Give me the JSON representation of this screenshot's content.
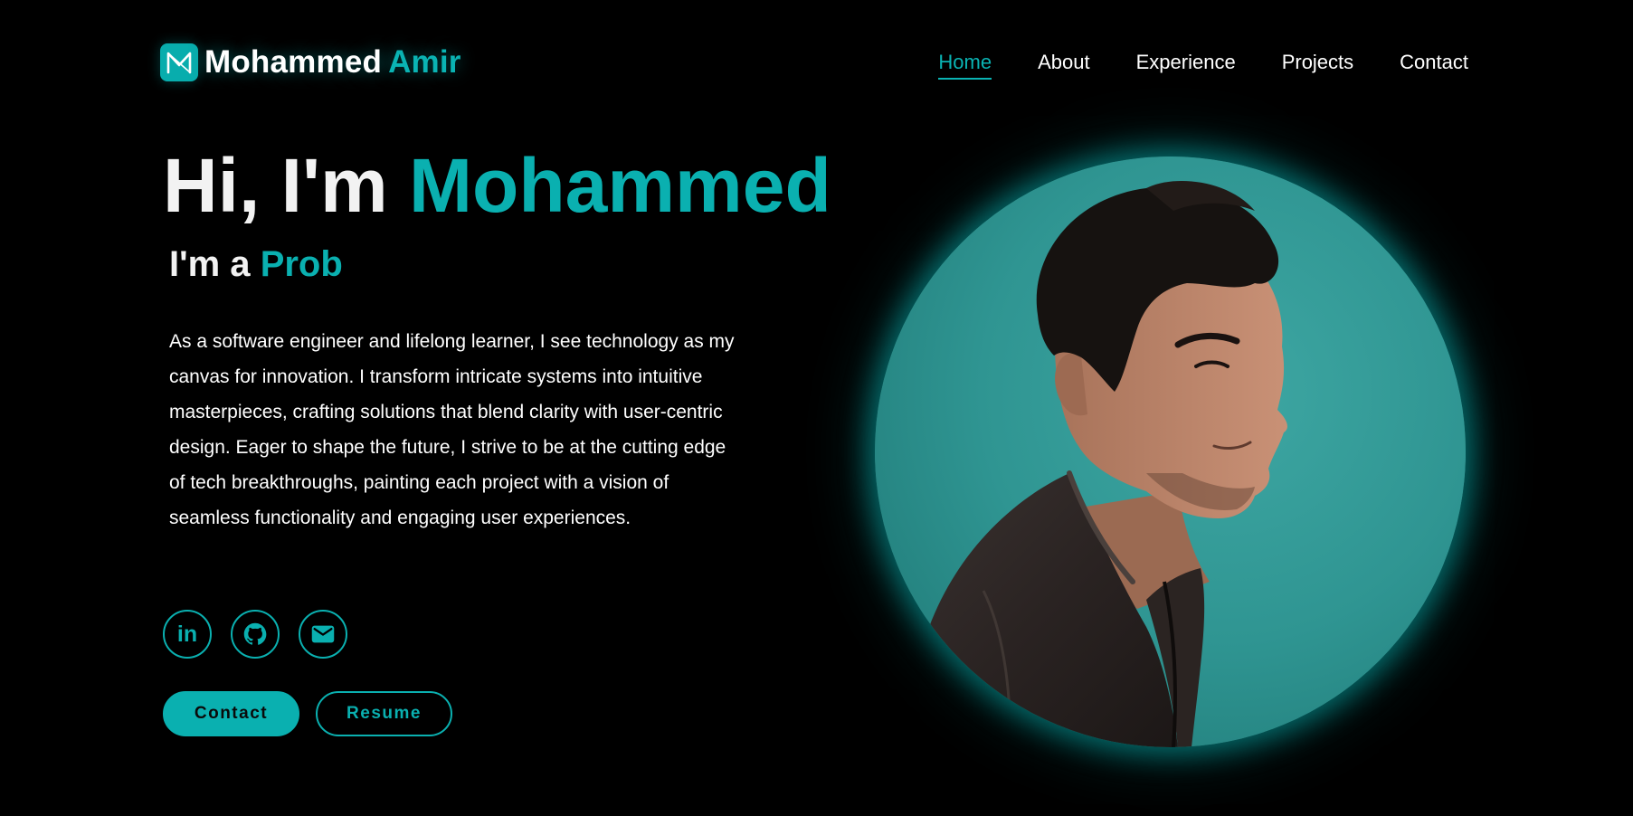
{
  "brand": {
    "first": "Mohammed",
    "last": "Amir",
    "icon": "m-logo-icon"
  },
  "nav": {
    "items": [
      {
        "label": "Home",
        "active": true
      },
      {
        "label": "About",
        "active": false
      },
      {
        "label": "Experience",
        "active": false
      },
      {
        "label": "Projects",
        "active": false
      },
      {
        "label": "Contact",
        "active": false
      }
    ]
  },
  "hero": {
    "greeting": "Hi, I'm",
    "name": "Mohammed",
    "role_prefix": "I'm a",
    "role_typed": "Prob",
    "bio": "As a software engineer and lifelong learner, I see technology as my canvas for innovation. I transform intricate systems into intuitive masterpieces, crafting solutions that blend clarity with user-centric design. Eager to shape the future, I strive to be at the cutting edge of tech breakthroughs, painting each project with a vision of seamless functionality and engaging user experiences."
  },
  "social": [
    {
      "name": "linkedin-icon",
      "label": "in"
    },
    {
      "name": "github-icon"
    },
    {
      "name": "mail-icon"
    }
  ],
  "actions": {
    "contact_label": "Contact",
    "resume_label": "Resume"
  },
  "colors": {
    "background": "#000000",
    "accent": "#0ab0b0",
    "text": "#ffffff"
  }
}
